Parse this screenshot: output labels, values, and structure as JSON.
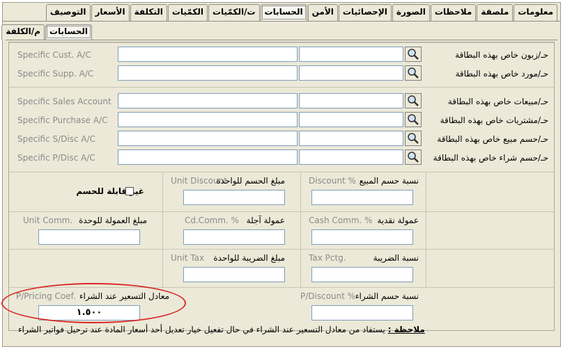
{
  "tabs": [
    "معلومات",
    "ملصقة",
    "ملاحظات",
    "الصورة",
    "الإحصائيات",
    "الأمن",
    "الحسابات",
    "ت/الكمّيات",
    "الكمّيات",
    "التكلفة",
    "الأسعار",
    "التوصيف"
  ],
  "selected_tab": "الحسابات",
  "subtabs": [
    "الحسابات",
    "م/الكلفة"
  ],
  "selected_subtab": "الحسابات",
  "accounts": [
    {
      "en": "Specific Cust. A/C",
      "ar": "حـ/زبون خاص بهذه البطاقة"
    },
    {
      "en": "Specific Supp. A/C",
      "ar": "حـ/مورد خاص بهذه البطاقة"
    },
    {
      "en": "Specific Sales Account",
      "ar": "حـ/مبيعات خاص بهذه البطاقة"
    },
    {
      "en": "Specific Purchase A/C",
      "ar": "حـ/مشتريات خاص بهذه البطاقة"
    },
    {
      "en": "Specific S/Disc A/C",
      "ar": "حـ/حسم مبيع خاص بهذه البطاقة"
    },
    {
      "en": "Specific P/Disc A/C",
      "ar": "حـ/حسم شراء خاص بهذه البطاقة"
    }
  ],
  "grid": {
    "not_discountable": "غير قابلة للحسم",
    "discount_pct_ar": "نسبة حسم المبيع",
    "discount_pct_en": "Discount %",
    "unit_discount_ar": "مبلغ الحسم للواحدة",
    "unit_discount_en": "Unit Discount",
    "cash_comm_ar": "عمولة نقدية",
    "cash_comm_en": "Cash Comm. %",
    "cd_comm_ar": "عمولة آجلة",
    "cd_comm_en": "Cd.Comm. %",
    "unit_comm_ar": "مبلغ العمولة للوحدة",
    "unit_comm_en": "Unit Comm.",
    "tax_pct_ar": "نسبة الضريبة",
    "tax_pct_en": "Tax Pctg.",
    "unit_tax_ar": "مبلغ الضريبة للواحدة",
    "unit_tax_en": "Unit Tax",
    "p_discount_ar": "نسبة حسم الشراء",
    "p_discount_en": "P/Discount %",
    "pricing_coef_ar": "معادل التسعير عند الشراء",
    "pricing_coef_en": "P/Pricing Coef.",
    "pricing_coef_value": "١.٥٠٠"
  },
  "note_label": "ملاحظة :",
  "note_text": "يستفاد من معادل التسعير عند الشراء في حال تفعيل خيار تعديل أحد أسعار المادة عند ترحيل فواتير الشراء",
  "colors": {
    "annotation_oval": "#d92b2b"
  }
}
